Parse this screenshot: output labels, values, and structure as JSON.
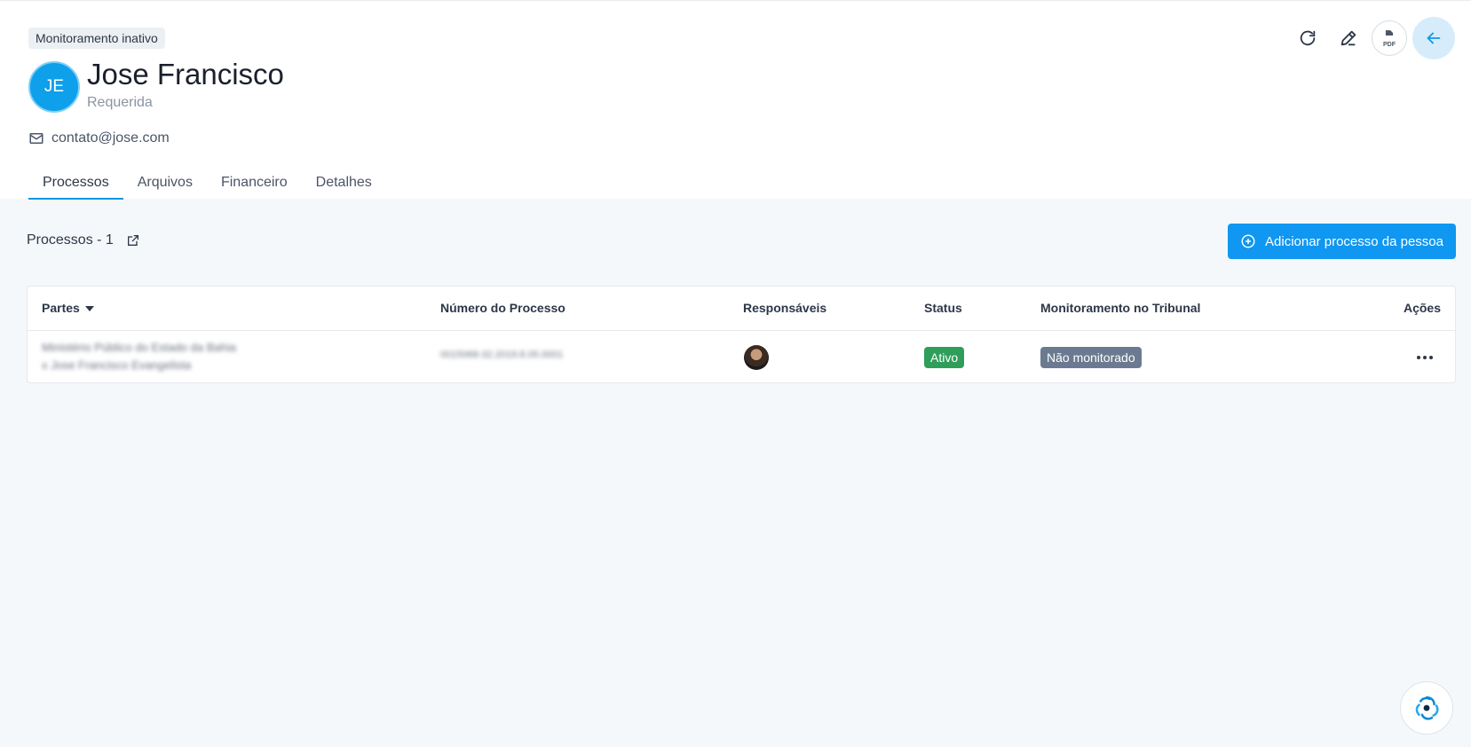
{
  "header": {
    "monitoring_badge": "Monitoramento inativo",
    "avatar_initials": "JE",
    "name": "Jose Francisco",
    "role": "Requerida",
    "email": "contato@jose.com",
    "pdf_label": "PDF"
  },
  "tabs": [
    {
      "label": "Processos",
      "active": true
    },
    {
      "label": "Arquivos",
      "active": false
    },
    {
      "label": "Financeiro",
      "active": false
    },
    {
      "label": "Detalhes",
      "active": false
    }
  ],
  "section": {
    "title": "Processos - 1",
    "add_button": "Adicionar processo da pessoa"
  },
  "table": {
    "columns": {
      "partes": "Partes",
      "numero": "Número do Processo",
      "responsaveis": "Responsáveis",
      "status": "Status",
      "monitoramento": "Monitoramento no Tribunal",
      "acoes": "Ações"
    },
    "rows": [
      {
        "partes_line1": "Ministério Público do Estado da Bahia",
        "partes_line2": "x Jose Francisco Evangelista",
        "numero": "0015068-32.2019.8.05.0001",
        "status": "Ativo",
        "monitoramento": "Não monitorado"
      }
    ]
  },
  "colors": {
    "accent": "#0f97f2",
    "status_active": "#2f9e5b",
    "status_unmonitored": "#6b7a90"
  }
}
